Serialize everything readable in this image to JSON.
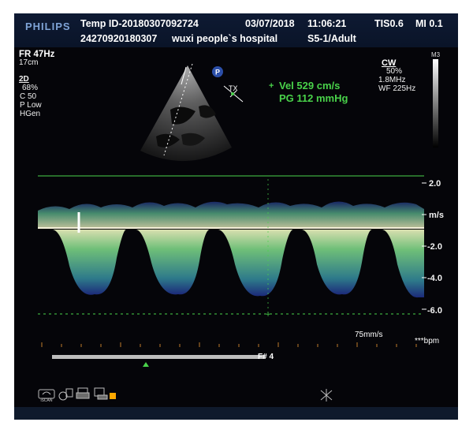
{
  "header": {
    "brand": "PHILIPS",
    "temp_id": "Temp ID-20180307092724",
    "patient_id": "24270920180307",
    "hospital": "wuxi people`s hospital",
    "date": "03/07/2018",
    "time": "11:06:21",
    "tis": "TIS0.6",
    "mi": "MI 0.1",
    "transducer": "S5-1/Adult"
  },
  "left_panel": {
    "fr": "FR 47Hz",
    "depth": "17cm",
    "mode": "2D",
    "gain_pct": "68%",
    "c": "C 50",
    "p": "P Low",
    "hgen": "HGen"
  },
  "measurements": {
    "vel": "Vel   529 cm/s",
    "pg": "PG  112 mmHg"
  },
  "right_panel": {
    "mode": "CW",
    "pct": "50%",
    "freq": "1.8MHz",
    "wf": "WF 225Hz",
    "map": "M3"
  },
  "axis": {
    "tick_labels": [
      "2.0",
      "m/s",
      "-2.0",
      "-4.0",
      "-6.0"
    ]
  },
  "sweep_speed": "75mm/s",
  "bpm": "***bpm",
  "frame": "F# 4",
  "bottom_icons": [
    "iscan-icon",
    "transducer-icon",
    "print-icon",
    "report-icon",
    "disk-icon"
  ],
  "colors": {
    "header_bg": "#0e1a33",
    "accent_green": "#49d24a",
    "brand": "#8fb4e6"
  }
}
